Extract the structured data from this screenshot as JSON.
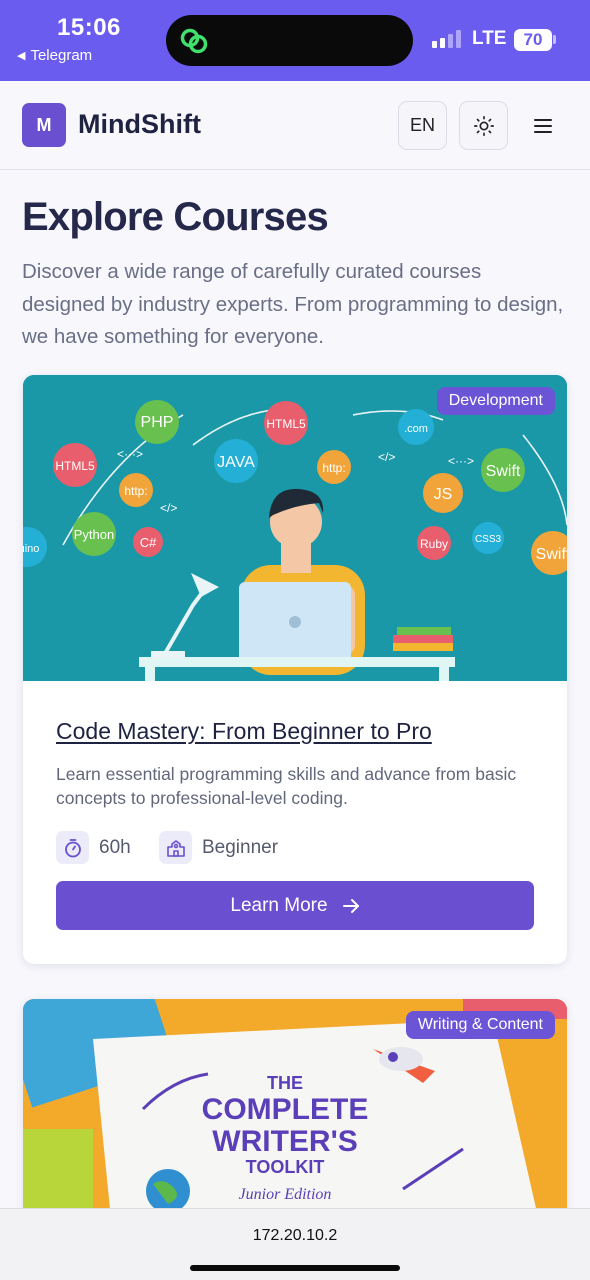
{
  "status_bar": {
    "time": "15:06",
    "back_app": "Telegram",
    "network": "LTE",
    "battery": "70"
  },
  "header": {
    "logo_letter": "M",
    "brand": "MindShift",
    "language": "EN",
    "theme_icon": "sun-icon",
    "menu_icon": "hamburger-menu-icon"
  },
  "main": {
    "title": "Explore Courses",
    "description": "Discover a wide range of carefully curated courses designed by industry experts. From programming to design, we have something for everyone."
  },
  "courses": [
    {
      "category": "Development",
      "title": "Code Mastery: From Beginner to Pro",
      "description": "Learn essential programming skills and advance from basic concepts to professional-level coding.",
      "duration": "60h",
      "level": "Beginner",
      "cta": "Learn More",
      "image_labels": [
        "PHP",
        "HTML5",
        "JAVA",
        "http:",
        ".com",
        "Swift",
        "HTML5",
        "http:",
        "JS",
        "Python",
        "C#",
        "Ruby",
        "CSS3",
        "Swift",
        "uino"
      ]
    },
    {
      "category": "Writing & Content",
      "image_labels": [
        "THE",
        "COMPLETE",
        "WRITER'S",
        "TOOLKIT",
        "Junior Edition"
      ]
    }
  ],
  "url_bar": {
    "url": "172.20.10.2"
  },
  "colors": {
    "status_bar": "#6b5cf0",
    "accent": "#6a4fd0",
    "badge": "#6c54d6",
    "card1_image_bg": "#1b98a8",
    "card2_image_bg": "#f3a92a"
  }
}
